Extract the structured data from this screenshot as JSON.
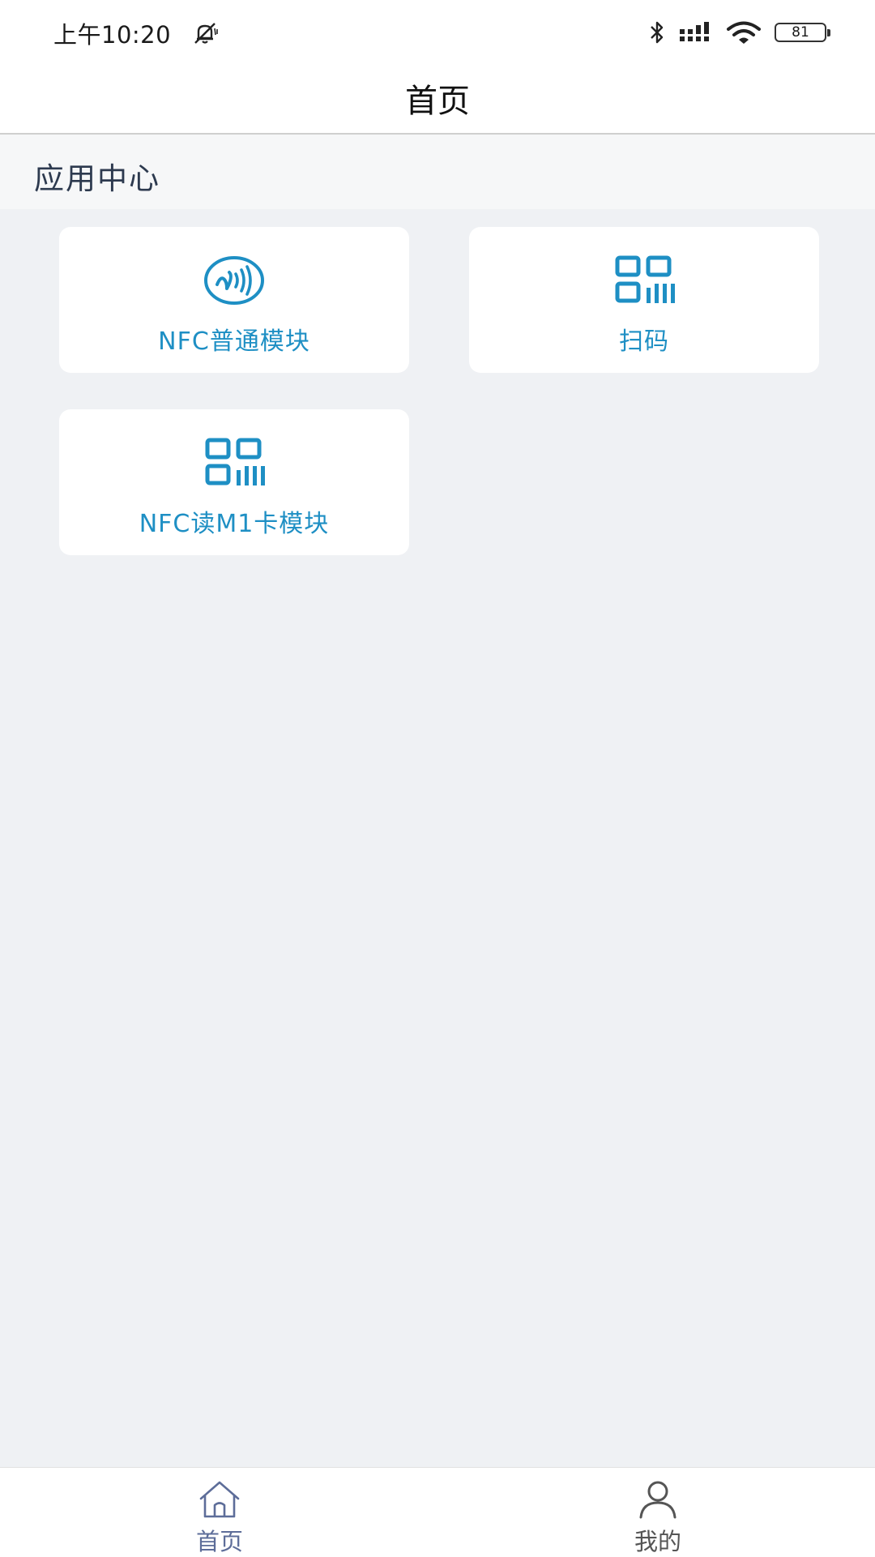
{
  "status_bar": {
    "time": "上午10:20",
    "battery": "81",
    "icons": [
      "mute-bell-icon",
      "bluetooth-icon",
      "signal-icon",
      "wifi-icon",
      "battery-icon"
    ]
  },
  "nav": {
    "title": "首页"
  },
  "section": {
    "title": "应用中心"
  },
  "tiles": [
    {
      "label": "NFC普通模块",
      "icon": "nfc-icon"
    },
    {
      "label": "扫码",
      "icon": "qr-scan-icon"
    },
    {
      "label": "NFC读M1卡模块",
      "icon": "qr-scan-icon"
    }
  ],
  "tab_bar": {
    "items": [
      {
        "label": "首页",
        "icon": "home-icon",
        "active": true
      },
      {
        "label": "我的",
        "icon": "user-icon",
        "active": false
      }
    ]
  },
  "colors": {
    "accent": "#1e8fc4",
    "tab_active": "#5d6d99",
    "background": "#eff1f4"
  }
}
